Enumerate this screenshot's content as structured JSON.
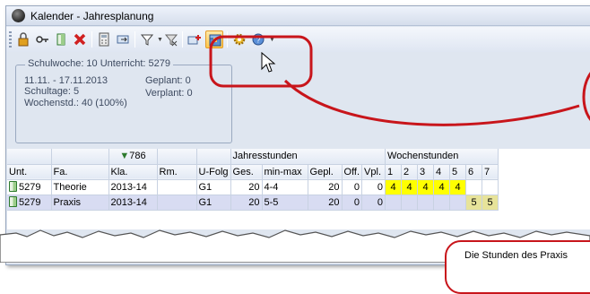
{
  "window": {
    "title": "Kalender - Jahresplanung"
  },
  "toolbar": {
    "buttons": [
      {
        "name": "lock-icon"
      },
      {
        "name": "key-icon"
      },
      {
        "name": "lesson-icon"
      },
      {
        "name": "delete-icon"
      },
      {
        "name": "calculator-icon"
      },
      {
        "name": "move-icon"
      },
      {
        "name": "filter-icon"
      },
      {
        "name": "clear-filter-icon"
      },
      {
        "name": "add-lesson-icon"
      },
      {
        "name": "package-icon",
        "active": true
      },
      {
        "name": "settings-icon"
      },
      {
        "name": "help-icon"
      }
    ]
  },
  "info": {
    "legend": "Schulwoche: 10  Unterricht: 5279",
    "date_range": "11.11. - 17.11.2013",
    "schooldays": "Schultage: 5",
    "weekly_hours": "Wochenstd.: 40 (100%)",
    "planned": "Geplant: 0",
    "scheduled": "Verplant: 0"
  },
  "grid": {
    "filter_value": "786",
    "group_headers": {
      "yearly": "Jahresstunden",
      "weekly": "Wochenstunden"
    },
    "columns": [
      "Unt.",
      "Fa.",
      "Kla.",
      "Rm.",
      "U-Folg",
      "Ges.",
      "min-max",
      "Gepl.",
      "Off.",
      "Vpl.",
      "1",
      "2",
      "3",
      "4",
      "5",
      "6",
      "7"
    ],
    "rows": [
      {
        "unt": "5279",
        "fa": "Theorie",
        "kla": "2013-14",
        "rm": "",
        "ufolg": "G1",
        "ges": "20",
        "minmax": "4-4",
        "gepl": "20",
        "off": "0",
        "vpl": "0",
        "weeks": [
          "4",
          "4",
          "4",
          "4",
          "4",
          "",
          ""
        ]
      },
      {
        "unt": "5279",
        "fa": "Praxis",
        "kla": "2013-14",
        "rm": "",
        "ufolg": "G1",
        "ges": "20",
        "minmax": "5-5",
        "gepl": "20",
        "off": "0",
        "vpl": "0",
        "weeks": [
          "",
          "",
          "",
          "",
          "",
          "5",
          "5"
        ]
      }
    ]
  },
  "callout": {
    "text": "Die Stunden des Praxis"
  },
  "colors": {
    "highlight_red": "#c8151b",
    "yellow_cell": "#ffff00",
    "olive_cell": "#e7e39a",
    "row_selected": "#d8dcf2"
  }
}
